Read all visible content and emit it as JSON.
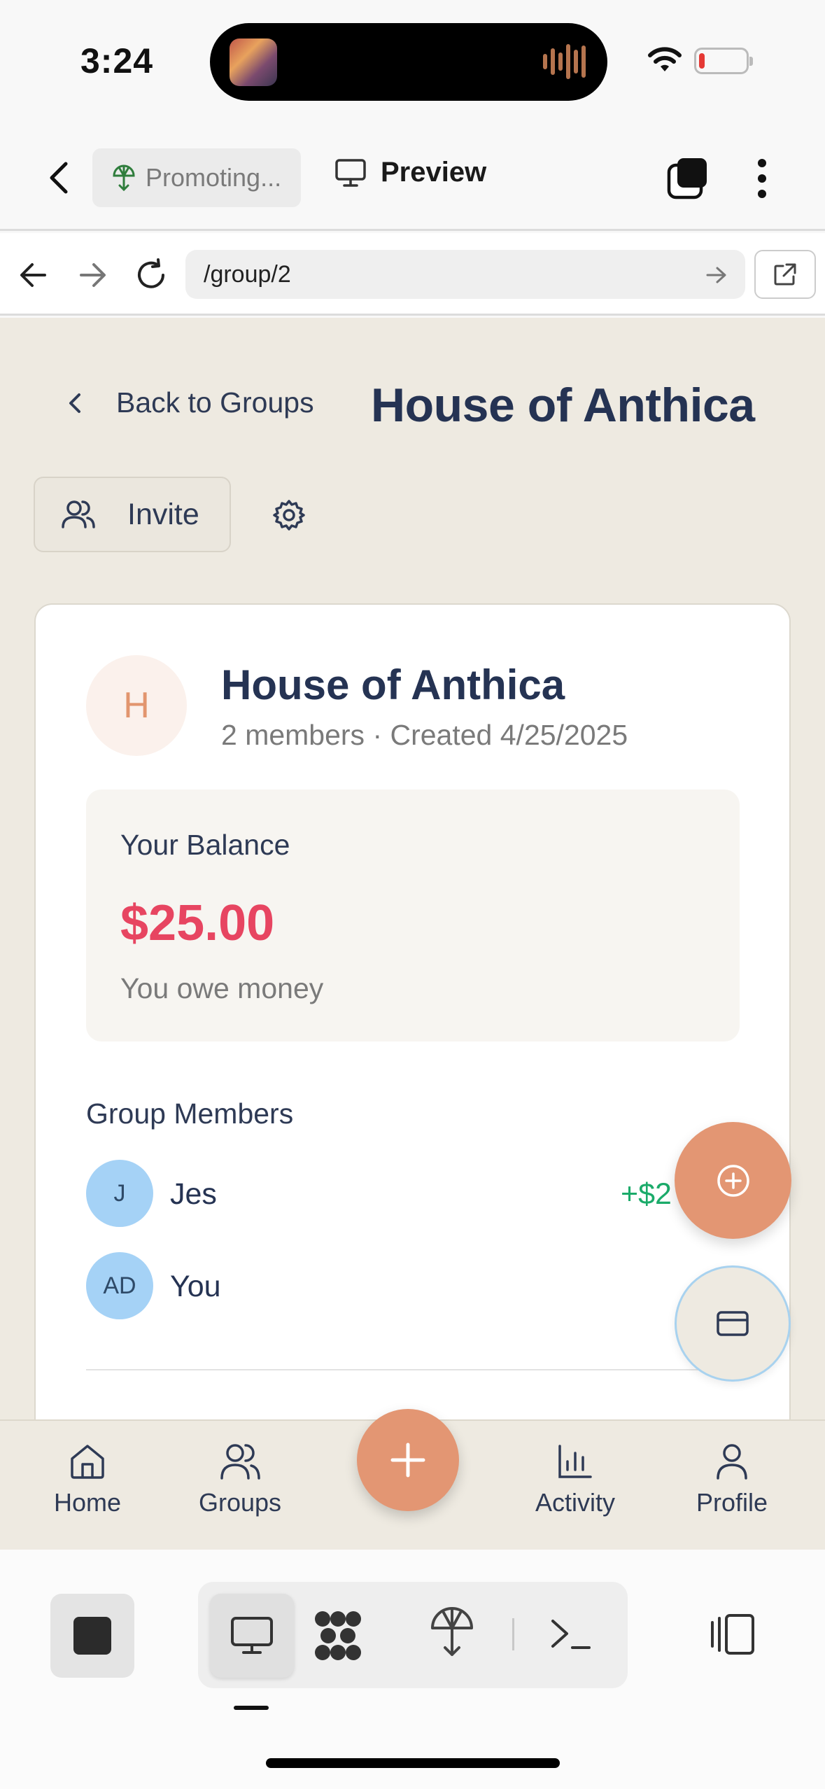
{
  "status_bar": {
    "time": "3:24"
  },
  "header": {
    "promo_label": "Promoting...",
    "preview_label": "Preview"
  },
  "browser": {
    "url": "/group/2"
  },
  "page": {
    "back_label": "Back to Groups",
    "title": "House of Anthica",
    "invite_label": "Invite"
  },
  "group": {
    "avatar_letter": "H",
    "name": "House of Anthica",
    "meta": "2 members · Created 4/25/2025",
    "balance_label": "Your Balance",
    "balance_amount": "$25.00",
    "balance_note": "You owe money",
    "members_label": "Group Members",
    "members": [
      {
        "initials": "J",
        "name": "Jes",
        "balance": "+$2"
      },
      {
        "initials": "AD",
        "name": "You",
        "balance": ""
      }
    ]
  },
  "tabs": [
    {
      "label": "Home",
      "icon": "home-icon"
    },
    {
      "label": "Groups",
      "icon": "users-icon"
    },
    {
      "label": "Activity",
      "icon": "bar-chart-icon"
    },
    {
      "label": "Profile",
      "icon": "user-icon"
    }
  ],
  "colors": {
    "accent": "#e39673",
    "negative": "#e74561",
    "positive": "#1bab6a",
    "title": "#253353",
    "page_bg": "#eeeae1"
  }
}
